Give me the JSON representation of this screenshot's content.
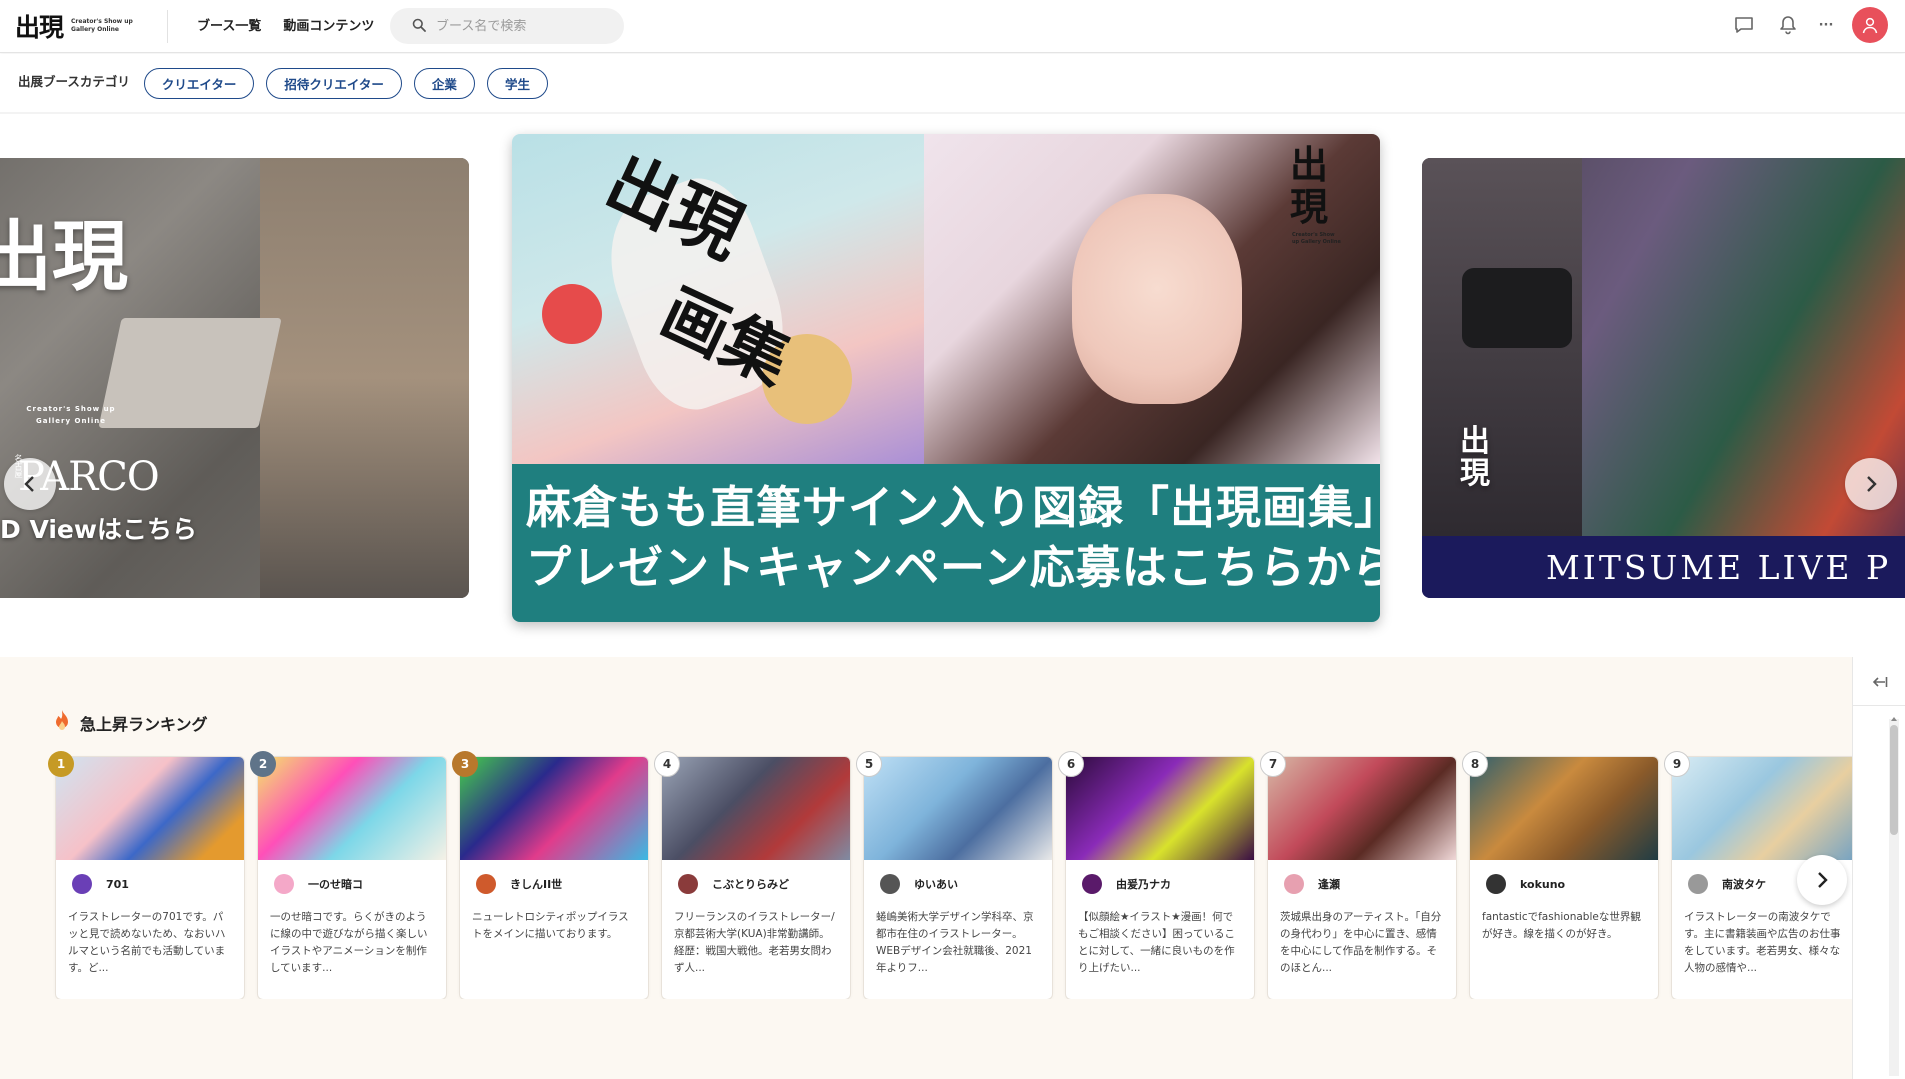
{
  "header": {
    "logo_text": "出現",
    "logo_sub": "Creator's Show up Gallery Online",
    "nav": [
      "ブース一覧",
      "動画コンテンツ"
    ],
    "search_placeholder": "ブース名で検索",
    "more_label": "···"
  },
  "categories": {
    "label": "出展ブースカテゴリ",
    "items": [
      "クリエイター",
      "招待クリエイター",
      "企業",
      "学生"
    ]
  },
  "carousel": {
    "left": {
      "logo": "出現",
      "logo_sub": "Creator's Show up Gallery Online",
      "small": "名古屋",
      "parco": "PARCO",
      "cta": "D Viewはこちら"
    },
    "center": {
      "art_title_1": "出現",
      "art_title_2": "画集",
      "logo": "出現",
      "logo_sub": "Creator's Show up Gallery Online",
      "headline_1": "麻倉もも直筆サイン入り図録「出現画集」",
      "headline_2": "プレゼントキャンペーン応募はこちらから!"
    },
    "right": {
      "logo": "出現",
      "band": "MITSUME LIVE P"
    },
    "dots_count": 7,
    "active_dot": 3,
    "progress_percent": 40
  },
  "ranking": {
    "title": "急上昇ランキング",
    "cards": [
      {
        "rank": "1",
        "name": "701",
        "desc": "イラストレーターの701です。パッと見で読めないため、なおいハルマという名前でも活動しています。ど...",
        "badge": "#c69a25",
        "img": "linear-gradient(135deg,#cfe4f1 0%,#f6c1c8 40%,#3c68c8 60%,#e49a2e 85%)",
        "av": "#6a3fb6"
      },
      {
        "rank": "2",
        "name": "一のせ暗コ",
        "desc": "一のせ暗コです。らくがきのように線の中で遊びながら描く楽しいイラストやアニメーションを制作しています...",
        "badge": "#7a8899",
        "img": "linear-gradient(135deg,#f4e56a 0%,#ff4fb8 35%,#7cd7e8 60%,#f5f1e6 100%)",
        "av": "#f4a8c8"
      },
      {
        "rank": "3",
        "name": "きしんII世",
        "desc": "ニューレトロシティポップイラストをメインに描いております。",
        "badge": "#b8782c",
        "img": "linear-gradient(135deg,#46d04a 0%,#2a2a8c 35%,#e13b8b 60%,#3bb9e3 100%)",
        "av": "#cf5a2c"
      },
      {
        "rank": "4",
        "name": "こぶとりらみど",
        "desc": "フリーランスのイラストレーター/京都芸術大学(KUA)非常勤講師。経歴：戦国大戦他。老若男女問わず人...",
        "badge": "#ffffff",
        "img": "linear-gradient(135deg,#9aa4b6 0%,#4b4e64 40%,#b23a3a 70%,#7f8ba3 100%)",
        "av": "#8a3b3b"
      },
      {
        "rank": "5",
        "name": "ゆいあい",
        "desc": "蜷嶋美術大学デザイン学科卒、京都市在住のイラストレーター。WEBデザイン会社就職後、2021年よりフ...",
        "badge": "#ffffff",
        "img": "linear-gradient(135deg,#bfe0f5 0%,#7fb4db 40%,#4c6ea0 65%,#e9e9e9 100%)",
        "av": "#555"
      },
      {
        "rank": "6",
        "name": "由爰乃ナカ",
        "desc": "【似顔絵★イラスト★漫画！何でもご相談ください】困っていることに対して、一緒に良いものを作り上げたい...",
        "badge": "#ffffff",
        "img": "linear-gradient(135deg,#2b0b3a 0%,#8a2bb8 40%,#d8e22c 65%,#3a0d44 100%)",
        "av": "#5a1a6a"
      },
      {
        "rank": "7",
        "name": "逢瀬",
        "desc": "茨城県出身のアーティスト。「自分の身代わり」を中心に置き、感情を中心にして作品を制作する。そのほとん...",
        "badge": "#ffffff",
        "img": "linear-gradient(135deg,#d7b8a6 0%,#c24a5a 40%,#5b2b24 65%,#f0d8d8 100%)",
        "av": "#e7a0b0"
      },
      {
        "rank": "8",
        "name": "kokuno",
        "desc": "fantasticでfashionableな世界観が好き。線を描くのが好き。",
        "badge": "#ffffff",
        "img": "linear-gradient(135deg,#2e5f6e 0%,#c98a3e 40%,#8a5a2a 65%,#1f3c44 100%)",
        "av": "#333"
      },
      {
        "rank": "9",
        "name": "南波タケ",
        "desc": "イラストレーターの南波タケです。主に書籍装画や広告のお仕事をしています。老若男女、様々な人物の感情や...",
        "badge": "#ffffff",
        "img": "linear-gradient(135deg,#d9ecf4 0%,#9ac7df 40%,#e8cfa0 65%,#6fa0c4 100%)",
        "av": "#999"
      }
    ]
  }
}
